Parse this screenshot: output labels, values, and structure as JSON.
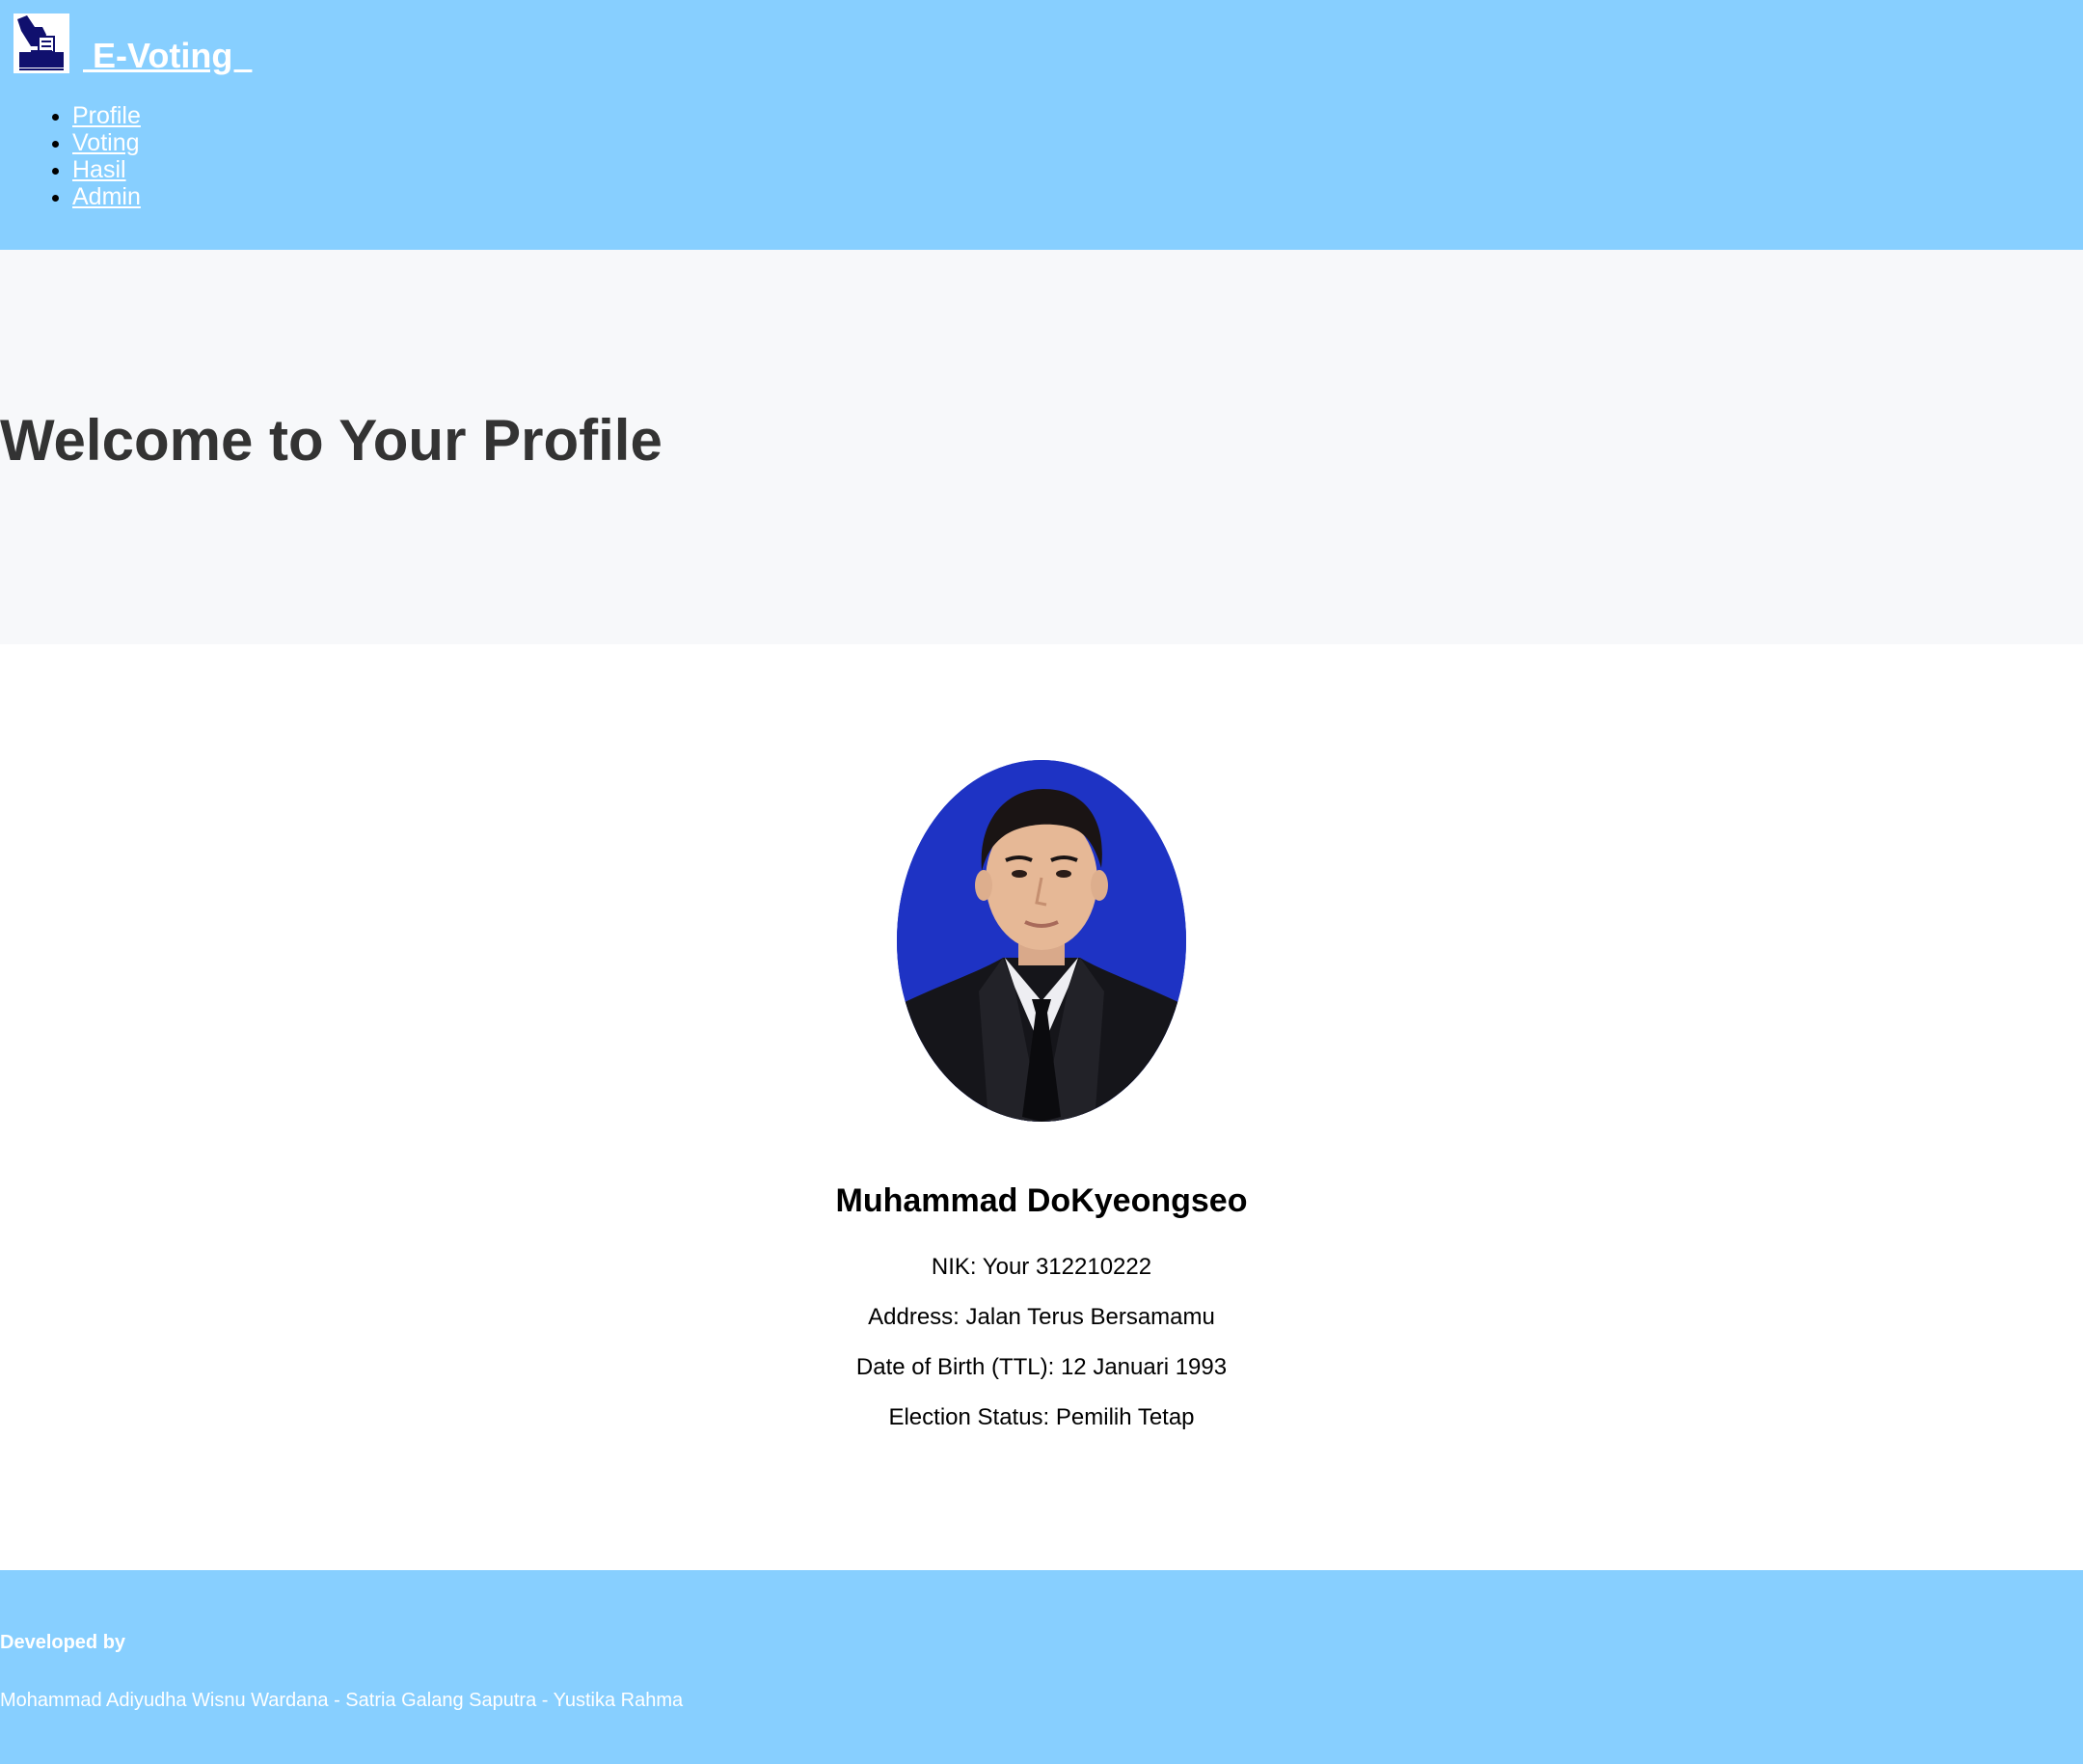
{
  "header": {
    "brand": " E-Voting  ",
    "nav": [
      {
        "label": "Profile"
      },
      {
        "label": "Voting"
      },
      {
        "label": "Hasil"
      },
      {
        "label": "Admin"
      }
    ]
  },
  "hero": {
    "title": "Welcome to Your Profile"
  },
  "profile": {
    "name": "Muhammad DoKyeongseo",
    "nik": "NIK: Your 312210222",
    "address": "Address: Jalan Terus Bersamamu",
    "dob": "Date of Birth (TTL): 12 Januari 1993",
    "status": "Election Status: Pemilih Tetap"
  },
  "footer": {
    "title": "Developed by",
    "names": "Mohammad Adiyudha Wisnu Wardana - Satria Galang Saputra - Yustika Rahma"
  },
  "colors": {
    "header_bg": "#87cfff",
    "hero_bg": "#f7f8fa",
    "avatar_bg": "#1e33c4",
    "logo_navy": "#10106e"
  }
}
